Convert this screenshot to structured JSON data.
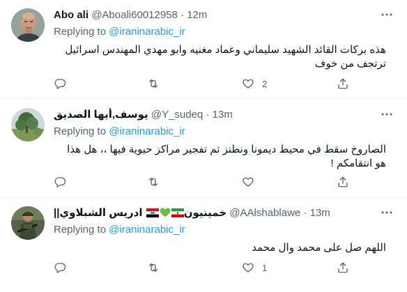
{
  "tweets": [
    {
      "name": "Abo ali",
      "handle": "@Aboali60012958",
      "time": "12m",
      "replying_label": "Replying to",
      "replying_to": "@iraninarabic_ir",
      "text": "هذه  بركات القائد الشهيد سليماني وعماد مغنيه وابو مهدي المهندس اسرائيل ترتجف من خوف",
      "counts": {
        "reply": "",
        "retweet": "",
        "like": "2"
      },
      "avatar": "bald-man-avatar"
    },
    {
      "name": "يوسف,أيها الصديق",
      "handle": "@Y_sudeq",
      "time": "13m",
      "replying_label": "Replying to",
      "replying_to": "@iraninarabic_ir",
      "text": "الصاروخ سقط في محيط ديمونا ونطنز تم تفجير مراكز حيوية فيها ،، هل هذا هو انتقامكم !",
      "counts": {
        "reply": "",
        "retweet": "",
        "like": ""
      },
      "avatar": "tree-landscape-avatar"
    },
    {
      "name_prefix": "ادريس الشبلاوي",
      "name_suffix": "||خمينيون",
      "flags": [
        "iraq-flag",
        "green-heart",
        "iran-flag"
      ],
      "handle": "@AAlshablawe",
      "time": "13m",
      "replying_label": "Replying to",
      "replying_to": "@iraninarabic_ir",
      "text": "اللهم صل على محمد وال محمد",
      "counts": {
        "reply": "",
        "retweet": "",
        "like": "1"
      },
      "avatar": "soldier-avatar"
    }
  ],
  "separator": "·",
  "more_icon": "more-dots-icon",
  "colors": {
    "text": "#0f1419",
    "muted": "#536471",
    "accent": "#1d9bf0",
    "divider": "#eff3f4"
  }
}
